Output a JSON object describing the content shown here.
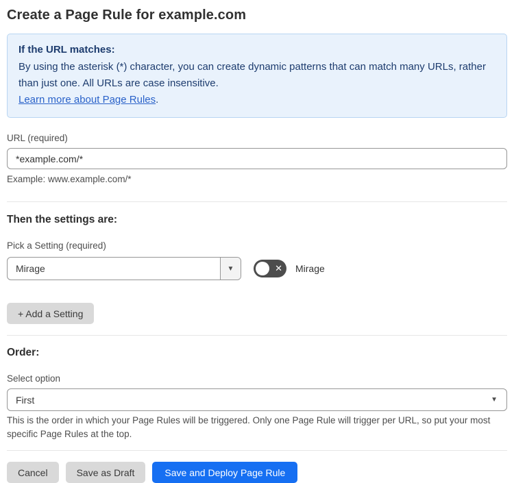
{
  "page": {
    "title": "Create a Page Rule for example.com"
  },
  "info_box": {
    "heading": "If the URL matches:",
    "body": "By using the asterisk (*) character, you can create dynamic patterns that can match many URLs, rather than just one. All URLs are case insensitive.",
    "link": "Learn more about Page Rules",
    "link_suffix": "."
  },
  "url_field": {
    "label": "URL (required)",
    "value": "*example.com/*",
    "example": "Example: www.example.com/*"
  },
  "settings_section": {
    "heading": "Then the settings are:",
    "pick_label": "Pick a Setting (required)",
    "selected_setting": "Mirage",
    "toggle_state": "off",
    "toggle_glyph": "✕",
    "toggle_label": "Mirage",
    "dropdown_caret": "▼",
    "add_button": "+ Add a Setting"
  },
  "order_section": {
    "heading": "Order:",
    "label": "Select option",
    "selected_option": "First",
    "dropdown_caret": "▼",
    "help": "This is the order in which your Page Rules will be triggered. Only one Page Rule will trigger per URL, so put your most specific Page Rules at the top."
  },
  "footer": {
    "cancel": "Cancel",
    "save_draft": "Save as Draft",
    "save_deploy": "Save and Deploy Page Rule"
  },
  "colors": {
    "primary_blue": "#166ff2",
    "info_bg": "#e9f2fc",
    "info_border": "#b8d5f2",
    "info_text": "#1d3c6e",
    "link_blue": "#2a62c9",
    "button_grey": "#d9d9d9",
    "toggle_off_bg": "#4d4d4d"
  }
}
